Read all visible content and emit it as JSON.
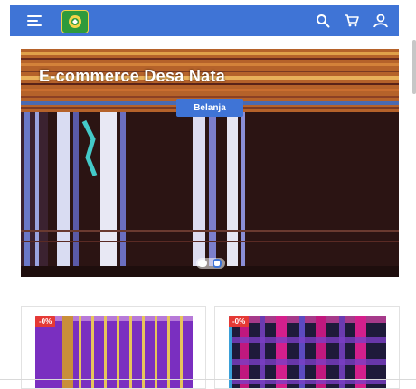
{
  "header": {
    "icons": {
      "menu": "menu-icon",
      "logo": "emblem-logo",
      "search": "search-icon",
      "cart": "cart-icon",
      "account": "user-icon"
    },
    "color": "#3f74d6"
  },
  "hero": {
    "title": "E-commerce Desa Nata",
    "button_label": "Belanja"
  },
  "products": [
    {
      "discount": "-0%"
    },
    {
      "discount": "-0%"
    }
  ]
}
